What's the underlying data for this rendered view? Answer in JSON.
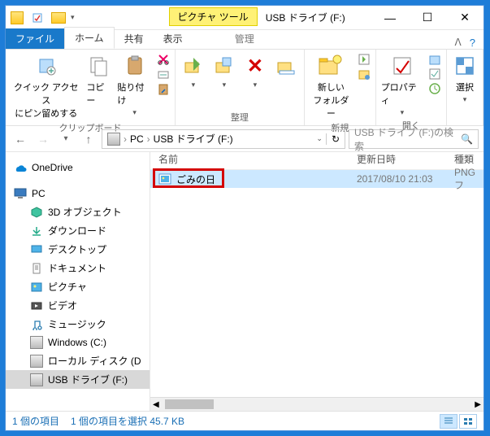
{
  "title": "USB ドライブ (F:)",
  "contextual_tab": "ピクチャ ツール",
  "tabs": {
    "file": "ファイル",
    "home": "ホーム",
    "share": "共有",
    "view": "表示",
    "manage": "管理"
  },
  "ribbon": {
    "clipboard": {
      "pin": "クイック アクセス\nにピン留めする",
      "copy": "コピー",
      "paste": "貼り付け",
      "label": "クリップボード"
    },
    "organize": {
      "label": "整理"
    },
    "new": {
      "newfolder": "新しい\nフォルダー",
      "label": "新規"
    },
    "open": {
      "properties": "プロパティ",
      "label": "開く"
    },
    "select": {
      "select": "選択",
      "label": ""
    }
  },
  "nav": {
    "pc": "PC",
    "location": "USB ドライブ (F:)",
    "search_placeholder": "USB ドライブ (F:)の検索"
  },
  "tree": {
    "onedrive": "OneDrive",
    "pc": "PC",
    "items": [
      "3D オブジェクト",
      "ダウンロード",
      "デスクトップ",
      "ドキュメント",
      "ピクチャ",
      "ビデオ",
      "ミュージック",
      "Windows (C:)",
      "ローカル ディスク (D",
      "USB ドライブ (F:)"
    ]
  },
  "columns": {
    "name": "名前",
    "date": "更新日時",
    "type": "種類"
  },
  "file": {
    "name": "ごみの日",
    "date": "2017/08/10 21:03",
    "type": "PNG フ"
  },
  "status": {
    "count": "1 個の項目",
    "selection": "1 個の項目を選択 45.7 KB"
  }
}
